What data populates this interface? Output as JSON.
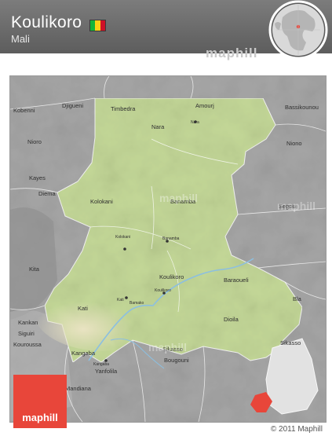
{
  "header": {
    "title": "Koulikoro",
    "subtitle": "Mali"
  },
  "flag_colors": [
    "#14b53a",
    "#fcd116",
    "#ce1126"
  ],
  "watermark": "maphill",
  "logo": {
    "text": "maphill",
    "color": "#e8463a"
  },
  "copyright": "© 2011 Maphill",
  "map": {
    "region_color": "#c5d99a",
    "surround_color": "#a7a7a7",
    "river_color": "#7fb6d8",
    "highlight_color": "#e8463a",
    "labels": {
      "kobenni": "Kobenni",
      "djigueni": "Djigueni",
      "timbedra": "Timbedra",
      "amourj": "Amourj",
      "bassikounou": "Bassikounou",
      "nara": "Nara",
      "nara_small": "Nara",
      "nioro": "Nioro",
      "niono": "Niono",
      "kayes": "Kayes",
      "diema": "Diema",
      "kolokani": "Kolokani",
      "kolokani_small": "Kolokani",
      "banamba": "Banamba",
      "banamba_small": "Banamba",
      "segou": "Segou",
      "kita": "Kita",
      "koulikoro": "Koulikoro",
      "koulikoro_small": "Koulikoro",
      "baraoueli": "Baraoueli",
      "bla": "Bla",
      "bamako": "Bamako",
      "kati": "Kati",
      "kati_small": "Kati",
      "dioila": "Dioila",
      "kankan": "Kankan",
      "siguiri": "Siguiri",
      "kangaba": "Kangaba",
      "kangaba_small": "Kangaba",
      "sikasso": "Sikasso",
      "sikasso_e": "Sikasso",
      "bougouni": "Bougouni",
      "yanfolila": "Yanfolila",
      "kouroussa": "Kouroussa",
      "mandiana": "Mandiana"
    }
  }
}
